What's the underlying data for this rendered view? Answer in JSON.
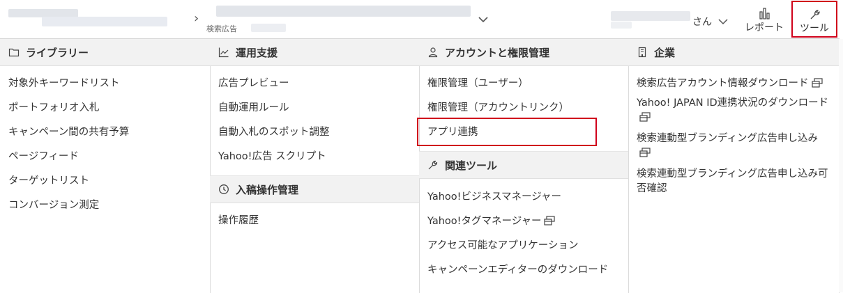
{
  "header": {
    "account_sub_label": "検索広告",
    "user_suffix": "さん",
    "report_label": "レポート",
    "tools_label": "ツール"
  },
  "menu": {
    "library": {
      "title": "ライブラリー",
      "items": [
        "対象外キーワードリスト",
        "ポートフォリオ入札",
        "キャンペーン間の共有予算",
        "ページフィード",
        "ターゲットリスト",
        "コンバージョン測定"
      ]
    },
    "operations": {
      "title": "運用支援",
      "items": [
        "広告プレビュー",
        "自動運用ルール",
        "自動入札のスポット調整",
        "Yahoo!広告 スクリプト"
      ]
    },
    "submissions": {
      "title": "入稿操作管理",
      "items": [
        "操作履歴"
      ]
    },
    "accounts": {
      "title": "アカウントと権限管理",
      "items": [
        "権限管理（ユーザー）",
        "権限管理（アカウントリンク）",
        "アプリ連携"
      ]
    },
    "related": {
      "title": "関連ツール",
      "items": [
        "Yahoo!ビジネスマネージャー",
        "Yahoo!タグマネージャー",
        "アクセス可能なアプリケーション",
        "キャンペーンエディターのダウンロード"
      ]
    },
    "company": {
      "title": "企業",
      "items": [
        "検索広告アカウント情報ダウンロード",
        "Yahoo! JAPAN ID連携状況のダウンロード",
        "検索連動型ブランディング広告申し込み",
        "検索連動型ブランディング広告申し込み可否確認"
      ]
    }
  }
}
